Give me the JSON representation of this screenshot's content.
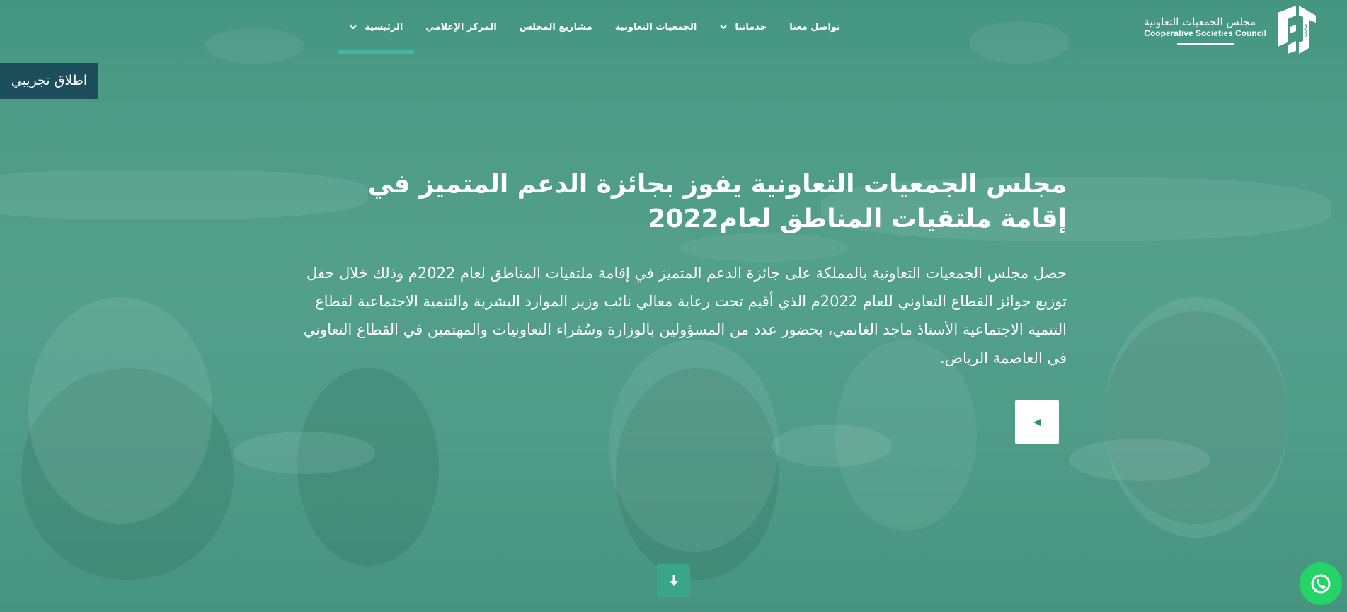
{
  "logo": {
    "arabic_name": "مجلس الجمعيات التعاونية",
    "english_name": "Cooperative Societies Council"
  },
  "nav": {
    "items": [
      {
        "label": "الرئيسية",
        "has_dropdown": true,
        "active": true
      },
      {
        "label": "المركز الإعلامي",
        "has_dropdown": false,
        "active": false
      },
      {
        "label": "مشاريع المجلس",
        "has_dropdown": false,
        "active": false
      },
      {
        "label": "الجمعيات التعاونية",
        "has_dropdown": false,
        "active": false
      },
      {
        "label": "خدماتنا",
        "has_dropdown": true,
        "active": false
      },
      {
        "label": "تواصل معنا",
        "has_dropdown": false,
        "active": false
      }
    ]
  },
  "beta_badge": "اطلاق تجريبي",
  "hero": {
    "headline": "مجلس الجمعيات التعاونية يفوز بجائزة الدعم المتميز في إقامة ملتقيات المناطق لعام2022",
    "body": "حصل مجلس الجمعيات التعاونية بالمملكة على جائزة الدعم المتميز في إقامة ملتقيات المناطق لعام 2022م وذلك خلال حفل توزيع جوائز القطاع التعاوني للعام 2022م الذي أقيم تحت رعاية معالي نائب وزير الموارد البشرية والتنمية الاجتماعية لقطاع التنمية الاجتماعية الأستاذ ماجد الغانمي، بحضور عدد من المسؤولين بالوزارة وسُفراء التعاونيات والمهتمين في القطاع التعاوني في العاصمة الرياض."
  },
  "icons": {
    "slide_control": "play-left-icon",
    "scroll_down": "arrow-down-icon",
    "whatsapp": "whatsapp-icon"
  },
  "colors": {
    "accent": "#45b79c",
    "badge_bg": "#1d4e5c",
    "whatsapp": "#25d366"
  }
}
